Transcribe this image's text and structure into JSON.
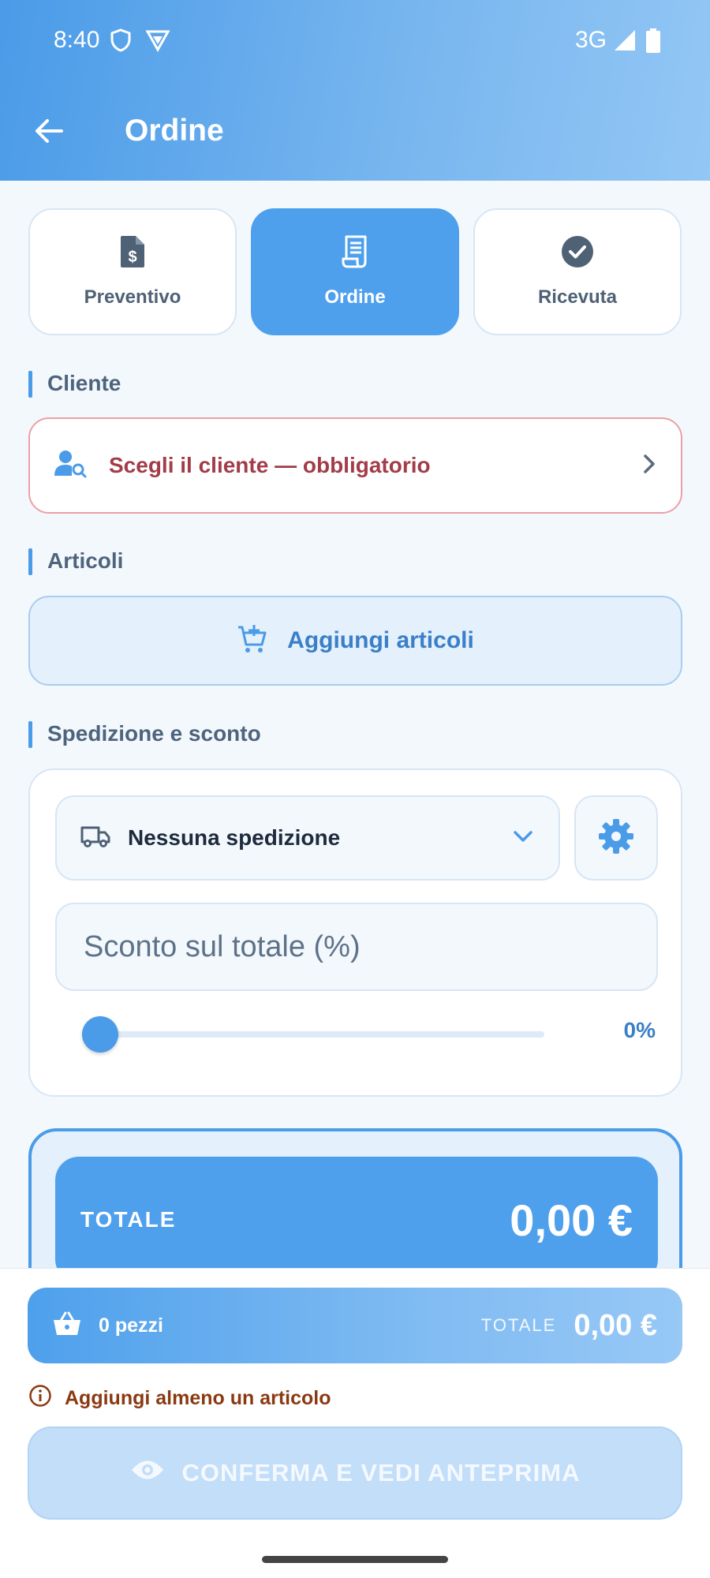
{
  "status_bar": {
    "time": "8:40",
    "network": "3G"
  },
  "app_bar": {
    "title": "Ordine"
  },
  "doc_tabs": [
    {
      "label": "Preventivo",
      "icon": "document-dollar-icon"
    },
    {
      "label": "Ordine",
      "icon": "receipt-icon"
    },
    {
      "label": "Ricevuta",
      "icon": "check-circle-icon"
    }
  ],
  "sections": {
    "cliente": "Cliente",
    "articoli": "Articoli",
    "spedizione": "Spedizione e sconto"
  },
  "client": {
    "label": "Scegli il cliente — obbligatorio"
  },
  "articles": {
    "add_label": "Aggiungi articoli"
  },
  "shipping": {
    "selected": "Nessuna spedizione",
    "discount_placeholder": "Sconto sul totale (%)",
    "discount_percent": 0,
    "discount_label": "0%"
  },
  "total": {
    "label": "TOTALE",
    "value": "0,00 €"
  },
  "summary": {
    "pieces": "0 pezzi",
    "total_label": "TOTALE",
    "total_value": "0,00 €",
    "warning": "Aggiungi almeno un articolo",
    "confirm_label": "CONFERMA E VEDI ANTEPRIMA"
  },
  "colors": {
    "accent": "#4a9be8",
    "error": "#a23c48",
    "warning": "#8a3a12"
  }
}
